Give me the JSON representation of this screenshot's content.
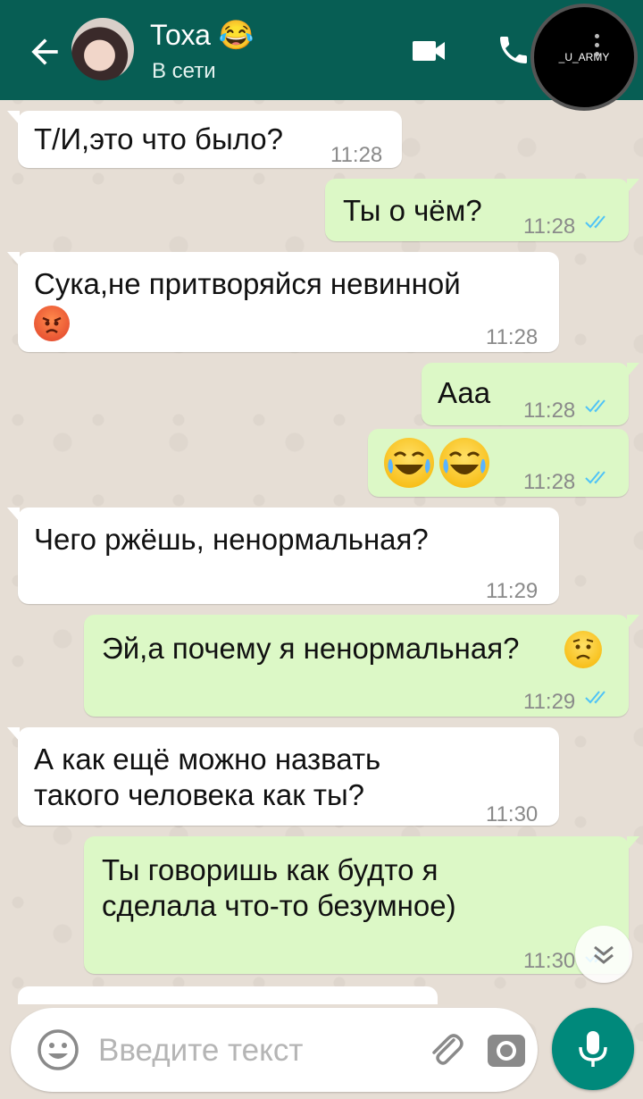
{
  "header": {
    "contact_name": "Тоха 😂",
    "status": "В сети",
    "watermark": "_U_ARMY"
  },
  "messages": [
    {
      "direction": "in",
      "text": "Т/И,это что было?",
      "time": "11:28"
    },
    {
      "direction": "out",
      "text": "Ты о чём?",
      "time": "11:28",
      "status": "read"
    },
    {
      "direction": "in",
      "text": "Сука,не притворяйся невинной",
      "emoji": "angry-face",
      "time": "11:28"
    },
    {
      "direction": "out",
      "text": "Ааа",
      "time": "11:28",
      "status": "read"
    },
    {
      "direction": "out",
      "emoji": "tears-of-joy x2",
      "time": "11:28",
      "status": "read"
    },
    {
      "direction": "in",
      "text": "Чего ржёшь, ненормальная?",
      "time": "11:29"
    },
    {
      "direction": "out",
      "text": "Эй,а почему я ненормальная?",
      "emoji": "worried-face",
      "time": "11:29",
      "status": "read"
    },
    {
      "direction": "in",
      "text": "А как ещё можно назвать такого человека как ты?",
      "time": "11:30"
    },
    {
      "direction": "out",
      "text": "Ты говоришь как будто я сделала что-то безумное)",
      "time": "11:30",
      "status": "read"
    }
  ],
  "input": {
    "placeholder": "Введите текст"
  },
  "colors": {
    "header": "#075e54",
    "incoming_bubble": "#ffffff",
    "outgoing_bubble": "#dcf8c6",
    "read_ticks": "#4fc3f7",
    "mic_button": "#00897b"
  }
}
